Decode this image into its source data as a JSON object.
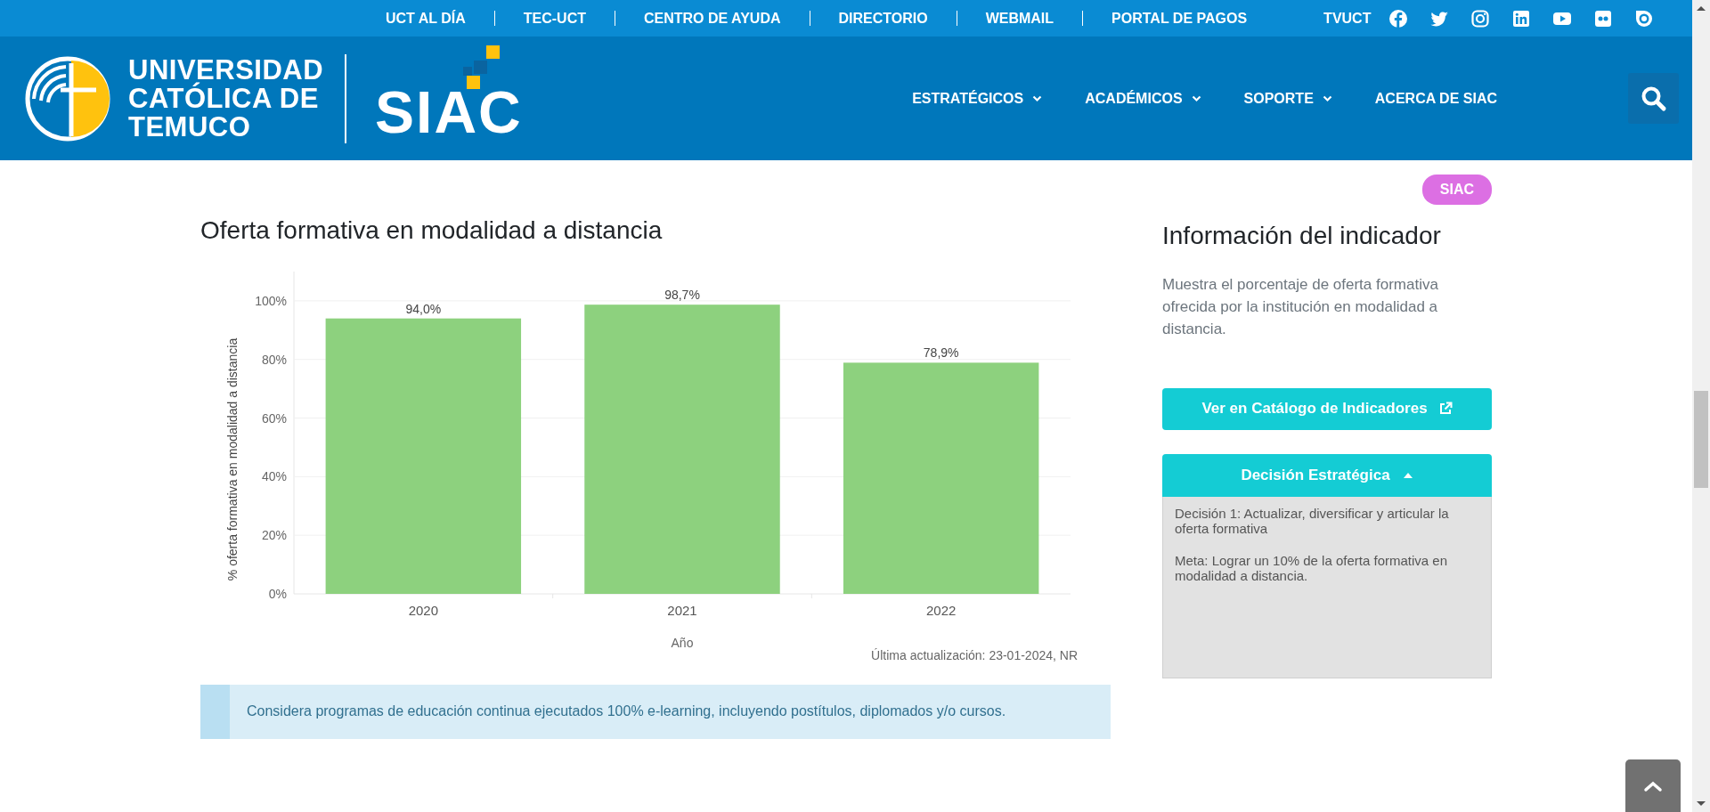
{
  "top_links": [
    {
      "label": "UCT AL DÍA"
    },
    {
      "label": "TEC-UCT"
    },
    {
      "label": "CENTRO DE AYUDA"
    },
    {
      "label": "DIRECTORIO"
    },
    {
      "label": "WEBMAIL"
    },
    {
      "label": "PORTAL DE PAGOS"
    },
    {
      "label": "TVUCT"
    }
  ],
  "social": [
    {
      "kind": "facebook"
    },
    {
      "kind": "twitter"
    },
    {
      "kind": "instagram"
    },
    {
      "kind": "linkedin"
    },
    {
      "kind": "youtube"
    },
    {
      "kind": "flickr"
    },
    {
      "kind": "issuu"
    }
  ],
  "header": {
    "university": [
      "UNIVERSIDAD",
      "CATÓLICA DE",
      "TEMUCO"
    ],
    "brand": "SIAC"
  },
  "nav": [
    {
      "label": "ESTRATÉGICOS",
      "has_menu": true
    },
    {
      "label": "ACADÉMICOS",
      "has_menu": true
    },
    {
      "label": "SOPORTE",
      "has_menu": true
    },
    {
      "label": "ACERCA DE SIAC",
      "has_menu": false
    }
  ],
  "main": {
    "title": "Oferta formativa en modalidad a distancia",
    "chart_data": {
      "type": "bar",
      "xlabel": "Año",
      "ylabel": "% oferta formativa en modalidad a distancia",
      "categories": [
        "2020",
        "2021",
        "2022"
      ],
      "series": [
        {
          "color": "#8dd17e",
          "values": [
            94.0,
            98.7,
            78.9
          ]
        }
      ],
      "ylim": [
        0,
        110
      ],
      "grid": true,
      "yticks": [
        {
          "value": 0,
          "label": "0%"
        },
        {
          "value": 20,
          "label": "20%"
        },
        {
          "value": 40,
          "label": "40%"
        },
        {
          "value": 60,
          "label": "60%"
        },
        {
          "value": 80,
          "label": "80%"
        },
        {
          "value": 100,
          "label": "100%"
        }
      ],
      "value_labels": [
        "94,0%",
        "98,7%",
        "78,9%"
      ]
    },
    "updated": "Última actualización: 23-01-2024, NR",
    "note": "Considera programas de educación continua ejecutados 100% e-learning, incluyendo postítulos, diplomados y/o cursos."
  },
  "sidebar": {
    "badge": "SIAC",
    "title": "Información del indicador",
    "description": "Muestra el porcentaje de oferta formativa ofrecida por la institución en modalidad a distancia.",
    "catalog_button": "Ver en Catálogo de Indicadores",
    "accordion": {
      "title": "Decisión Estratégica",
      "expanded": true,
      "paragraphs": [
        "Decisión 1: Actualizar, diversificar y articular la oferta formativa",
        "Meta: Lograr un 10% de la oferta formativa en modalidad a distancia."
      ]
    }
  }
}
